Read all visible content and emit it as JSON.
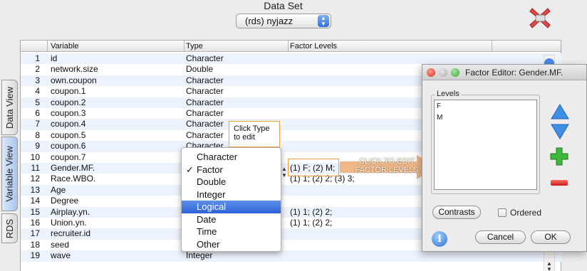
{
  "dataset": {
    "label": "Data Set",
    "selected": "(rds) nyjazz"
  },
  "side_tabs": {
    "data_view": "Data View",
    "variable_view": "Variable View",
    "rds": "RDS"
  },
  "table": {
    "columns": [
      "Variable",
      "Type",
      "Factor Levels"
    ],
    "rows": [
      {
        "num": "1",
        "variable": "id",
        "type": "Character",
        "levels": ""
      },
      {
        "num": "2",
        "variable": "network.size",
        "type": "Double",
        "levels": ""
      },
      {
        "num": "3",
        "variable": "own.coupon",
        "type": "Character",
        "levels": ""
      },
      {
        "num": "4",
        "variable": "coupon.1",
        "type": "Character",
        "levels": ""
      },
      {
        "num": "5",
        "variable": "coupon.2",
        "type": "Character",
        "levels": ""
      },
      {
        "num": "6",
        "variable": "coupon.3",
        "type": "Character",
        "levels": ""
      },
      {
        "num": "7",
        "variable": "coupon.4",
        "type": "Character",
        "levels": ""
      },
      {
        "num": "8",
        "variable": "coupon.5",
        "type": "Character",
        "levels": ""
      },
      {
        "num": "9",
        "variable": "coupon.6",
        "type": "Character",
        "levels": ""
      },
      {
        "num": "10",
        "variable": "coupon.7",
        "type": "",
        "levels": ""
      },
      {
        "num": "11",
        "variable": "Gender.MF.",
        "type": "",
        "levels": "(1) F; (2) M;"
      },
      {
        "num": "12",
        "variable": "Race.WBO.",
        "type": "",
        "levels": "(1) 1; (2) 2; (3) 3;"
      },
      {
        "num": "13",
        "variable": "Age",
        "type": "",
        "levels": ""
      },
      {
        "num": "14",
        "variable": "Degree",
        "type": "",
        "levels": ""
      },
      {
        "num": "15",
        "variable": "Airplay.yn.",
        "type": "",
        "levels": "(1) 1; (2) 2;"
      },
      {
        "num": "16",
        "variable": "Union.yn.",
        "type": "",
        "levels": "(1) 1; (2) 2;"
      },
      {
        "num": "17",
        "variable": "recruiter.id",
        "type": "",
        "levels": ""
      },
      {
        "num": "18",
        "variable": "seed",
        "type": "",
        "levels": ""
      },
      {
        "num": "19",
        "variable": "wave",
        "type": "Integer",
        "levels": ""
      }
    ]
  },
  "type_menu": {
    "items": [
      {
        "label": "Character",
        "check": ""
      },
      {
        "label": "Factor",
        "check": "✓"
      },
      {
        "label": "Double",
        "check": ""
      },
      {
        "label": "Integer",
        "check": ""
      },
      {
        "label": "Logical",
        "check": ""
      },
      {
        "label": "Date",
        "check": ""
      },
      {
        "label": "Time",
        "check": ""
      },
      {
        "label": "Other",
        "check": ""
      }
    ],
    "highlighted": "Logical"
  },
  "callouts": {
    "type_line1": "Click Type",
    "type_line2": "to edit",
    "levels_line1": "CLICK TO EDIT",
    "levels_line2": "FACTOR LEVELS"
  },
  "factor_editor": {
    "title": "Factor Editor: Gender.MF.",
    "levels_label": "Levels",
    "levels": [
      "F",
      "M"
    ],
    "contrasts_button": "Contrasts",
    "ordered_label": "Ordered",
    "ordered_checked": false,
    "cancel_button": "Cancel",
    "ok_button": "OK",
    "info_glyph": "i"
  },
  "colors": {
    "accent": "#2d62d8",
    "callout_border": "#f0a040",
    "add": "#3db83a",
    "remove": "#c81c1c"
  }
}
